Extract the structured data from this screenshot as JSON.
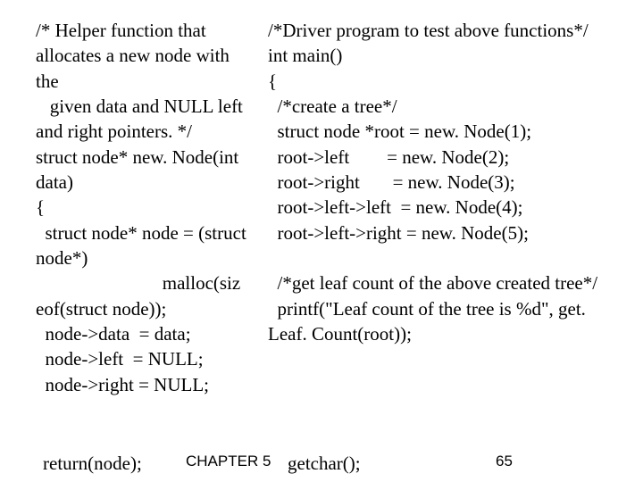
{
  "left": {
    "l1": "/* Helper function that allocates a new node with the",
    "l2": "   given data and NULL left and right pointers. */",
    "l3": "struct node* new. Node(int data)",
    "l4": "{",
    "l5": "  struct node* node = (struct node*)",
    "l6": "                           malloc(siz eof(struct node));",
    "l7": "  node->data  = data;",
    "l8": "  node->left  = NULL;",
    "l9": "  node->right = NULL;"
  },
  "right": {
    "r1": "/*Driver program to test above functions*/",
    "r2": "int main()",
    "r3": "{",
    "r4": "  /*create a tree*/",
    "r5": "  struct node *root = new. Node(1);",
    "r6": "  root->left        = new. Node(2);",
    "r7": "  root->right       = new. Node(3);",
    "r8": "  root->left->left  = new. Node(4);",
    "r9": "  root->left->right = new. Node(5);",
    "r10": " ",
    "r11": "  /*get leaf count of the above created tree*/",
    "r12": "  printf(\"Leaf count of the tree is %d\", get. Leaf. Count(root));"
  },
  "footer": {
    "return_node": "  return(node);",
    "chapter": "CHAPTER 5",
    "getchar": "  getchar();",
    "page": "65"
  }
}
